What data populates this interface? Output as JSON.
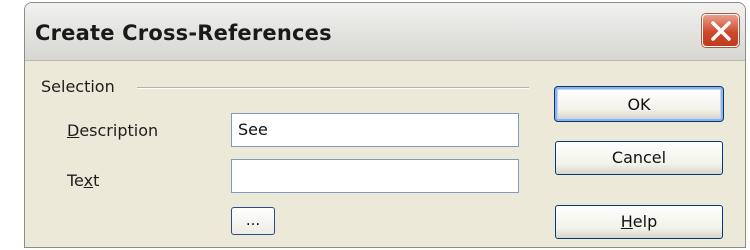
{
  "dialog": {
    "title": "Create Cross-References",
    "close_icon": "close-icon"
  },
  "selection": {
    "group_label": "Selection",
    "description": {
      "label_prefix": "",
      "label_mnemonic": "D",
      "label_rest": "escription",
      "value": "See"
    },
    "text": {
      "label_prefix": "Te",
      "label_mnemonic": "x",
      "label_rest": "t",
      "value": ""
    },
    "browse_button_label": "..."
  },
  "buttons": {
    "ok": "OK",
    "cancel": "Cancel",
    "help_mnemonic": "H",
    "help_rest": "elp"
  },
  "colors": {
    "title_bar": "#e4e4e0",
    "close_button": "#d04a2c",
    "dialog_face": "#ece9d8",
    "button_border": "#003c74"
  }
}
